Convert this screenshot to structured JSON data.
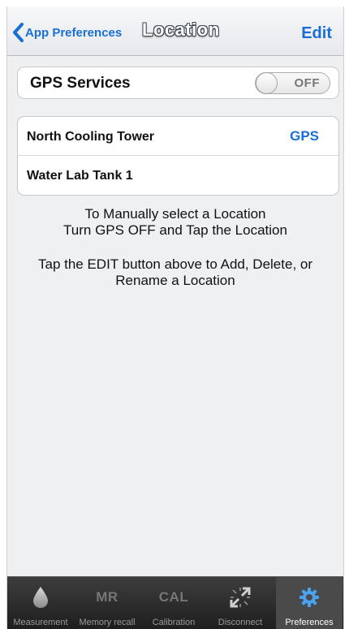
{
  "nav": {
    "back_label": "App Preferences",
    "title": "Location",
    "edit_label": "Edit"
  },
  "gps": {
    "label": "GPS Services",
    "toggle_state": "OFF"
  },
  "locations": [
    {
      "name": "North Cooling Tower",
      "tag": "GPS"
    },
    {
      "name": "Water Lab Tank 1",
      "tag": ""
    }
  ],
  "info": {
    "line1": "To Manually select a Location",
    "line2": "Turn GPS OFF and Tap the Location",
    "line3": "Tap the EDIT button above to Add, Delete, or",
    "line4": "Rename a Location"
  },
  "tabs": [
    {
      "label": "Measurement",
      "icon": "water-drop-icon",
      "icon_text": ""
    },
    {
      "label": "Memory recall",
      "icon": "memory-recall-icon",
      "icon_text": "MR"
    },
    {
      "label": "Calibration",
      "icon": "calibration-icon",
      "icon_text": "CAL"
    },
    {
      "label": "Disconnect",
      "icon": "disconnect-icon",
      "icon_text": ""
    },
    {
      "label": "Preferences",
      "icon": "gear-icon",
      "icon_text": "",
      "active": true
    }
  ],
  "colors": {
    "accent": "#1a6fd6",
    "tabbar": "#2a2a2a",
    "active_icon": "#4aa3f0"
  }
}
